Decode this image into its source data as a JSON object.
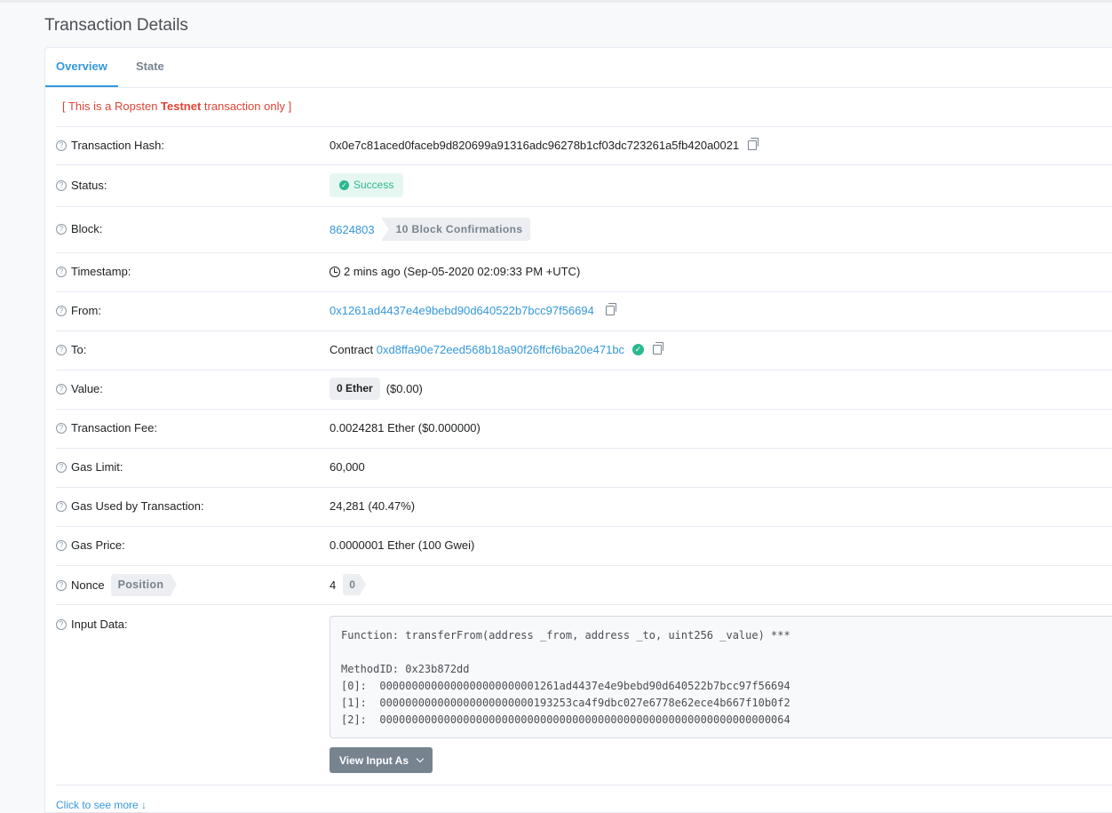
{
  "page_title": "Transaction Details",
  "tabs": [
    {
      "label": "Overview",
      "active": true
    },
    {
      "label": "State",
      "active": false
    }
  ],
  "testnet_notice": {
    "prefix": "[ This is a Ropsten ",
    "bold": "Testnet",
    "suffix": " transaction only ]"
  },
  "rows": {
    "hash": {
      "label": "Transaction Hash:",
      "value": "0x0e7c81aced0faceb9d820699a91316adc96278b1cf03dc723261a5fb420a0021"
    },
    "status": {
      "label": "Status:",
      "value": "Success"
    },
    "block": {
      "label": "Block:",
      "value": "8624803",
      "confirmations": "10 Block Confirmations"
    },
    "timestamp": {
      "label": "Timestamp:",
      "value": "2 mins ago (Sep-05-2020 02:09:33 PM +UTC)"
    },
    "from": {
      "label": "From:",
      "value": "0x1261ad4437e4e9bebd90d640522b7bcc97f56694"
    },
    "to": {
      "label": "To:",
      "prefix": "Contract",
      "value": "0xd8ffa90e72eed568b18a90f26ffcf6ba20e471bc"
    },
    "value": {
      "label": "Value:",
      "amount": "0 Ether",
      "usd": "($0.00)"
    },
    "fee": {
      "label": "Transaction Fee:",
      "value": "0.0024281 Ether ($0.000000)"
    },
    "gas_limit": {
      "label": "Gas Limit:",
      "value": "60,000"
    },
    "gas_used": {
      "label": "Gas Used by Transaction:",
      "value": "24,281 (40.47%)"
    },
    "gas_price": {
      "label": "Gas Price:",
      "value": "0.0000001 Ether (100 Gwei)"
    },
    "nonce": {
      "label": "Nonce",
      "tag": "Position",
      "value": "4",
      "position": "0"
    },
    "input": {
      "label": "Input Data:",
      "text": "Function: transferFrom(address _from, address _to, uint256 _value) ***\n\nMethodID: 0x23b872dd\n[0]:  0000000000000000000000001261ad4437e4e9bebd90d640522b7bcc97f56694\n[1]:  000000000000000000000000193253ca4f9dbc027e6778e62ece4b667f10b0f2\n[2]:  0000000000000000000000000000000000000000000000000000000000000064",
      "button": "View Input As"
    }
  },
  "more_link": "Click to see more ↓",
  "colors": {
    "link": "#3498db",
    "success": "#2bb891",
    "testnet": "#de4437"
  }
}
